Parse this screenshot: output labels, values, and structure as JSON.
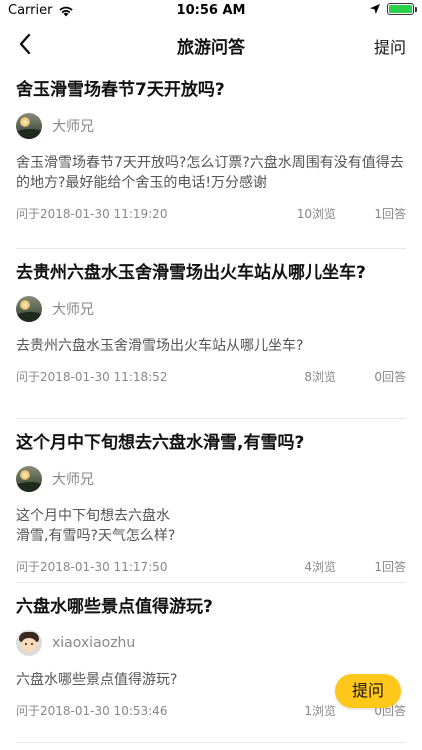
{
  "status_bar": {
    "carrier": "Carrier",
    "time": "10:56 AM",
    "battery_level": 1.0,
    "battery_color": "#2bd04a"
  },
  "nav": {
    "title": "旅游问答",
    "ask_label": "提问",
    "back_icon": "chevron-left-icon"
  },
  "questions": [
    {
      "title": "舍玉滑雪场春节7天开放吗?",
      "author": "大师兄",
      "avatar": "landscape",
      "body": "舍玉滑雪场春节7天开放吗?怎么订票?六盘水周围有没有值得去的地方?最好能给个舍玉的电话!万分感谢",
      "time": "问于2018-01-30 11:19:20",
      "views": "10浏览",
      "answers": "1回答"
    },
    {
      "title": "去贵州六盘水玉舍滑雪场出火车站从哪儿坐车?",
      "author": "大师兄",
      "avatar": "landscape",
      "body": "去贵州六盘水玉舍滑雪场出火车站从哪儿坐车?",
      "time": "问于2018-01-30 11:18:52",
      "views": "8浏览",
      "answers": "0回答"
    },
    {
      "title": "这个月中下旬想去六盘水滑雪,有雪吗?",
      "author": "大师兄",
      "avatar": "landscape",
      "body": "这个月中下旬想去六盘水\n滑雪,有雪吗?天气怎么样?",
      "time": "问于2018-01-30 11:17:50",
      "views": "4浏览",
      "answers": "1回答"
    },
    {
      "title": "六盘水哪些景点值得游玩?",
      "author": "xiaoxiaozhu",
      "avatar": "cartoon",
      "body": "六盘水哪些景点值得游玩?",
      "time": "问于2018-01-30 10:53:46",
      "views": "1浏览",
      "answers": "0回答"
    }
  ],
  "fab": {
    "label": "提问",
    "color": "#ffc81a"
  }
}
